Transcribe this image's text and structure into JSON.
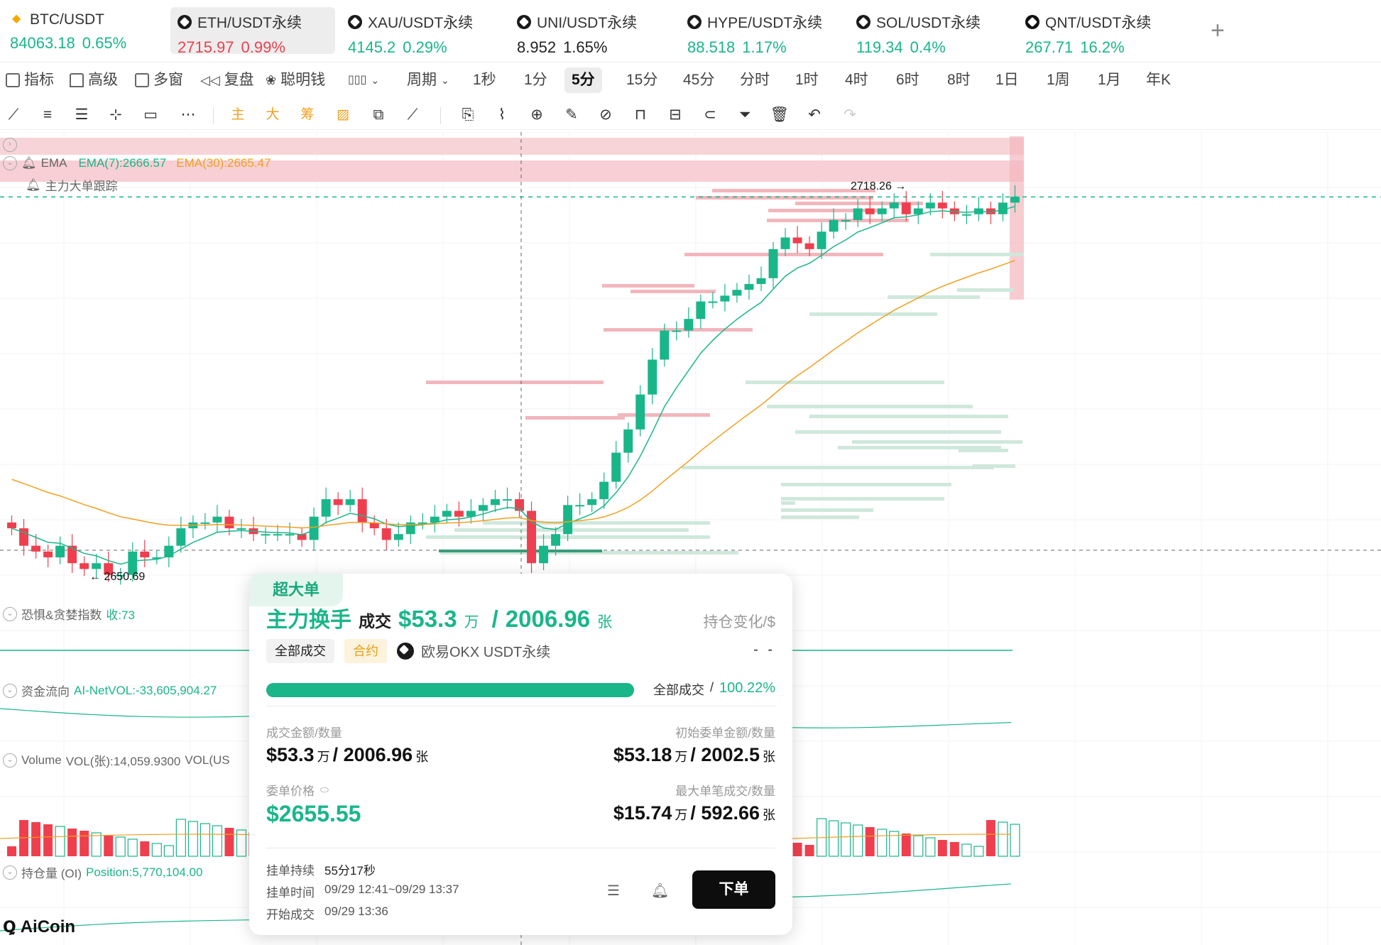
{
  "tickers": [
    {
      "symbol": "BTC/USDT",
      "price": "84063.18",
      "change": "0.65%",
      "color": "#19b68a",
      "icon": "btc-icon",
      "active": false
    },
    {
      "symbol": "ETH/USDT永续",
      "price": "2715.97",
      "change": "0.99%",
      "color": "#ef3f4e",
      "icon": "okx-icon",
      "active": true
    },
    {
      "symbol": "XAU/USDT永续",
      "price": "4145.2",
      "change": "0.29%",
      "color": "#19b68a",
      "icon": "okx-icon",
      "active": false
    },
    {
      "symbol": "UNI/USDT永续",
      "price": "8.952",
      "change": "1.65%",
      "color": "#222222",
      "icon": "okx-icon",
      "active": false
    },
    {
      "symbol": "HYPE/USDT永续",
      "price": "88.518",
      "change": "1.17%",
      "color": "#19b68a",
      "icon": "okx-icon",
      "active": false
    },
    {
      "symbol": "SOL/USDT永续",
      "price": "119.34",
      "change": "0.4%",
      "color": "#19b68a",
      "icon": "okx-icon",
      "active": false
    },
    {
      "symbol": "QNT/USDT永续",
      "price": "267.71",
      "change": "16.2%",
      "color": "#19b68a",
      "icon": "qnt-icon",
      "active": false
    }
  ],
  "periodbar": {
    "indicator": "指标",
    "advanced": "高级",
    "multiwindow": "多窗",
    "replay": "复盘",
    "smartmoney": "聪明钱",
    "period_select": "周期",
    "periods": [
      "1秒",
      "1分",
      "5分",
      "15分",
      "45分",
      "分时",
      "1时",
      "4时",
      "6时",
      "8时",
      "1日",
      "1周",
      "1月",
      "年K"
    ],
    "active_period": "5分"
  },
  "toolbar": {
    "labels": [
      "主",
      "大",
      "筹"
    ]
  },
  "chart": {
    "ema_label": "EMA",
    "ema7": "EMA(7):2666.57",
    "ema30": "EMA(30):2665.47",
    "whale_track": "主力大单跟踪",
    "high_label": "2718.26 →",
    "low_label": "← 2650.69",
    "fear_greed": "恐惧&贪婪指数",
    "fear_greed_value": "收:73",
    "fund_flow": "资金流向",
    "fund_flow_value": "AI-NetVOL:-33,605,904.27",
    "volume": "Volume",
    "volume_value": "VOL(张):14,059.9300",
    "volume_value2": "VOL(US",
    "oi": "持仓量 (OI)",
    "oi_value": "Position:5,770,104.00",
    "logo": "AiCoin",
    "colors": {
      "up": "#19b68a",
      "down": "#ef3f4e",
      "ema7": "#19b68a",
      "ema30": "#f0a020"
    }
  },
  "chart_data": {
    "type": "candlestick",
    "title": "ETH/USDT永续",
    "interval": "5分",
    "high": 2718.26,
    "low": 2650.69,
    "last": 2715.97,
    "close_approx": [
      2659,
      2656,
      2655,
      2654,
      2656,
      2653,
      2652,
      2653,
      2651,
      2651,
      2655,
      2654,
      2654,
      2656,
      2659,
      2660,
      2660,
      2661,
      2659,
      2659,
      2658,
      2658,
      2658,
      2658,
      2657,
      2661,
      2664,
      2663,
      2664,
      2660,
      2659,
      2657,
      2658,
      2660,
      2660,
      2661,
      2662,
      2661,
      2662,
      2663,
      2664,
      2664,
      2662,
      2653,
      2656,
      2658,
      2663,
      2663,
      2664,
      2667,
      2672,
      2676,
      2682,
      2688,
      2693,
      2693,
      2695,
      2698,
      2698,
      2699,
      2700,
      2701,
      2702,
      2707,
      2709,
      2708,
      2707,
      2710,
      2712,
      2712,
      2714,
      2713,
      2714,
      2715,
      2713,
      2714,
      2715,
      2714,
      2713,
      2713,
      2714,
      2713,
      2715,
      2716
    ],
    "ema7_last": 2666.57,
    "ema30_last": 2665.47
  },
  "card": {
    "tag": "超大单",
    "title": "主力换手",
    "deal_label": "成交",
    "amount": "$53.3",
    "amount_unit": "万",
    "separator": "/",
    "qty": "2006.96",
    "qty_unit": "张",
    "oi_change": "持仓变化/$",
    "tag_all": "全部成交",
    "tag_contract": "合约",
    "exchange": "欧易OKX USDT永续",
    "dash": "- -",
    "progress": 1.0,
    "progress_label": "全部成交",
    "progress_slash": "/",
    "progress_value": "100.22%",
    "deal_amt_label": "成交金额/数量",
    "deal_amt_value": "$53.3",
    "deal_amt_unit": "万",
    "deal_amt_qty": "/ 2006.96",
    "deal_amt_qty_unit": "张",
    "init_label": "初始委单金额/数量",
    "init_value": "$53.18",
    "init_unit": "万",
    "init_qty": "/ 2002.5",
    "init_qty_unit": "张",
    "price_label": "委单价格",
    "price_value": "$2655.55",
    "max_label": "最大单笔成交/数量",
    "max_value": "$15.74",
    "max_unit": "万",
    "max_qty": "/ 592.66",
    "max_qty_unit": "张",
    "dur_label": "挂单持续",
    "dur_value": "55分17秒",
    "time_label": "挂单时间",
    "time_value": "09/29 12:41~09/29 13:37",
    "start_label": "开始成交",
    "start_value": "09/29 13:36",
    "order_button": "下单"
  }
}
